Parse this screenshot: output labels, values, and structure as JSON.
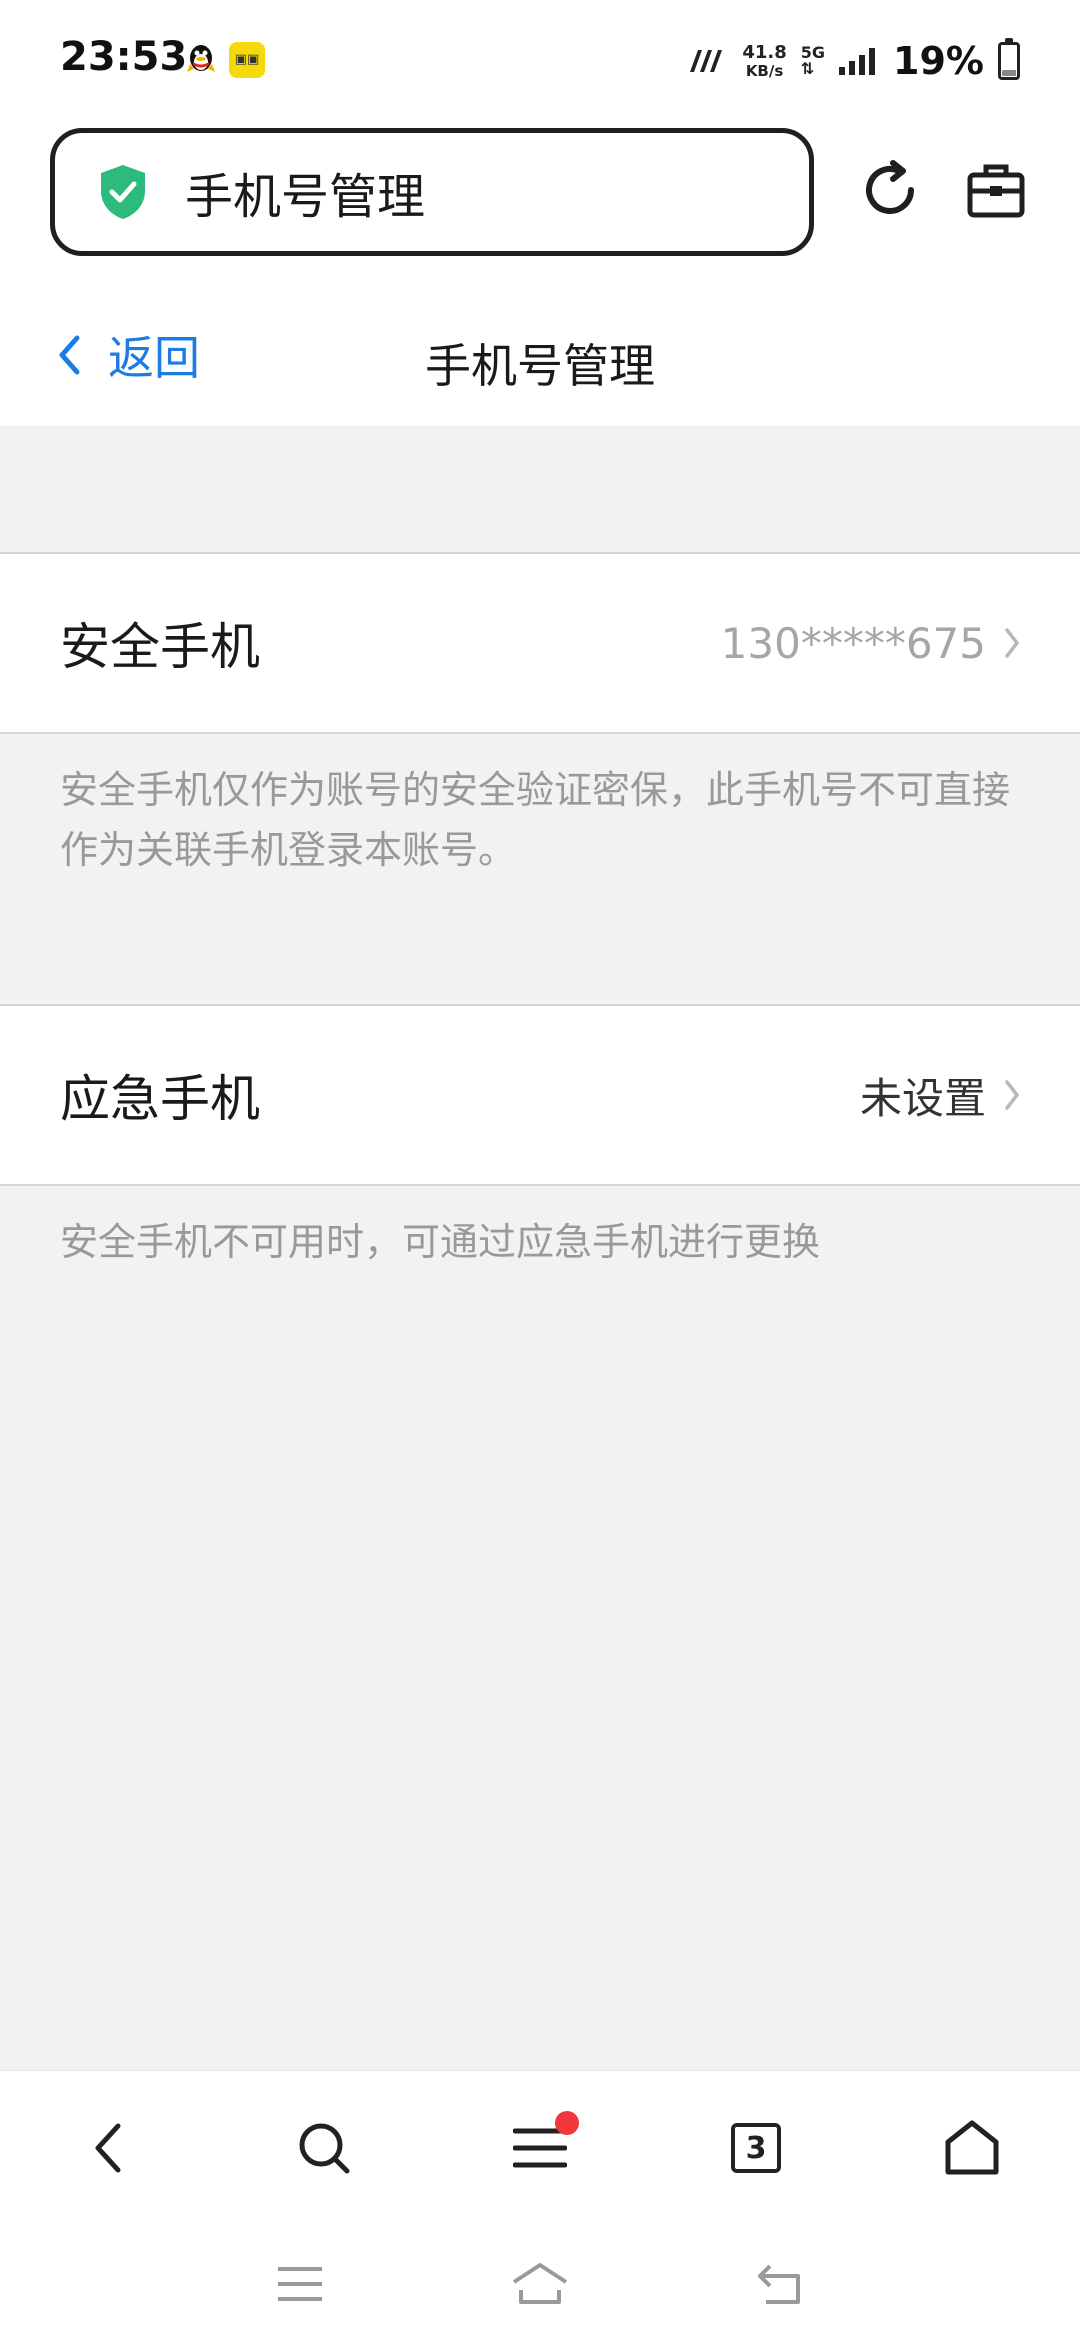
{
  "status_bar": {
    "time": "23:53",
    "network_speed_value": "41.8",
    "network_speed_unit": "KB/s",
    "network_type": "5G",
    "battery_percent": "19%",
    "battery_level": 0.19
  },
  "browser": {
    "url_title": "手机号管理"
  },
  "header": {
    "back_label": "返回",
    "title": "手机号管理"
  },
  "rows": [
    {
      "label": "安全手机",
      "value": "130*****675",
      "hint": "安全手机仅作为账号的安全验证密保，此手机号不可直接作为关联手机登录本账号。"
    },
    {
      "label": "应急手机",
      "value": "未设置",
      "hint": "安全手机不可用时，可通过应急手机进行更换"
    }
  ],
  "toolbar": {
    "tab_count": "3"
  },
  "colors": {
    "link_blue": "#1d7be3",
    "shield_green": "#2dbb7d",
    "badge_red": "#f2363c",
    "page_bg": "#f2f2f2"
  },
  "icons": [
    "qq-icon",
    "app-notification-icon",
    "signal-icon",
    "battery-icon",
    "shield-check-icon",
    "refresh-icon",
    "toolbox-icon",
    "chevron-left-icon",
    "chevron-right-icon",
    "back-icon",
    "search-icon",
    "menu-icon",
    "tabs-icon",
    "home-icon",
    "recents-icon",
    "sys-home-icon",
    "sys-back-icon"
  ]
}
